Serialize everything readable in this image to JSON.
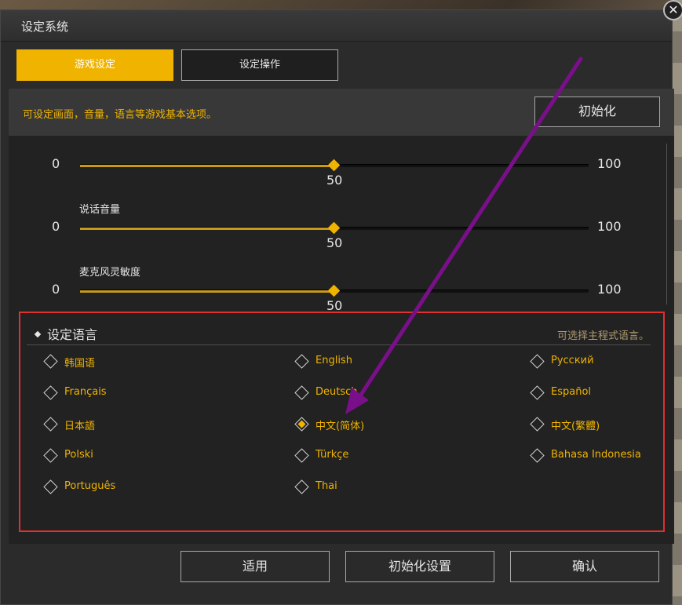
{
  "window": {
    "title": "设定系统",
    "close_glyph": "✕"
  },
  "tabs": [
    {
      "label": "游戏设定",
      "active": true
    },
    {
      "label": "设定操作",
      "active": false
    }
  ],
  "description": "可设定画面，音量，语言等游戏基本选项。",
  "reset_button": "初始化",
  "sliders": [
    {
      "label": "",
      "min": "0",
      "max": "100",
      "value": "50",
      "value_fraction": 0.5
    },
    {
      "label": "说话音量",
      "min": "0",
      "max": "100",
      "value": "50",
      "value_fraction": 0.5
    },
    {
      "label": "麦克风灵敏度",
      "min": "0",
      "max": "100",
      "value": "50",
      "value_fraction": 0.5
    }
  ],
  "language": {
    "header": "设定语言",
    "hint": "可选择主程式语言。",
    "options": [
      {
        "label": "韩国语",
        "checked": false
      },
      {
        "label": "English",
        "checked": false
      },
      {
        "label": "Русский",
        "checked": false
      },
      {
        "label": "Français",
        "checked": false
      },
      {
        "label": "Deutsch",
        "checked": false
      },
      {
        "label": "Español",
        "checked": false
      },
      {
        "label": "日本語",
        "checked": false
      },
      {
        "label": "中文(简体)",
        "checked": true
      },
      {
        "label": "中文(繁體)",
        "checked": false
      },
      {
        "label": "Polski",
        "checked": false
      },
      {
        "label": "Türkçe",
        "checked": false
      },
      {
        "label": "Bahasa Indonesia",
        "checked": false
      },
      {
        "label": "Português",
        "checked": false
      },
      {
        "label": "Thai",
        "checked": false
      }
    ]
  },
  "footer": {
    "apply": "适用",
    "reset_settings": "初始化设置",
    "confirm": "确认"
  },
  "colors": {
    "accent": "#f0b400",
    "highlight_box": "#e0302f",
    "annotation_arrow": "#7a0f8a"
  }
}
